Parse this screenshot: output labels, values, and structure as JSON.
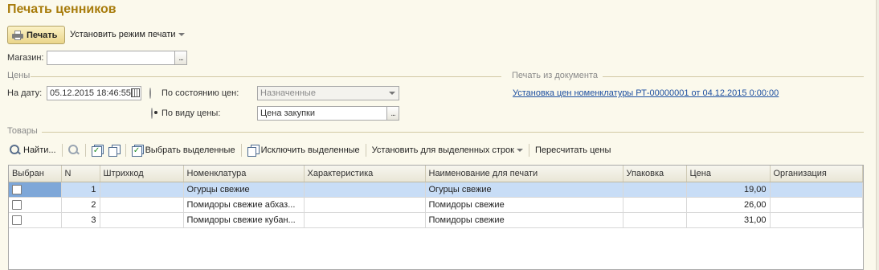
{
  "title": "Печать ценников",
  "toolbar": {
    "print_label": "Печать",
    "mode_label": "Установить режим печати"
  },
  "store": {
    "label": "Магазин:",
    "value": ""
  },
  "prices": {
    "section_title": "Цены",
    "date_label": "На дату:",
    "date_value": "05.12.2015 18:46:55",
    "by_state_label": "По состоянию цен:",
    "by_state_value": "Назначенные",
    "by_type_label": "По виду цены:",
    "by_type_value": "Цена закупки",
    "selected_option": "by_type"
  },
  "print_from_doc": {
    "section_title": "Печать из документа",
    "link_text": "Установка цен номенклатуры РТ-00000001 от 04.12.2015 0:00:00"
  },
  "goods": {
    "section_title": "Товары",
    "toolbar": {
      "find_label": "Найти...",
      "select_selected_label": "Выбрать выделенные",
      "exclude_selected_label": "Исключить выделенные",
      "set_for_rows_label": "Установить для выделенных строк",
      "recalc_label": "Пересчитать цены"
    },
    "columns": [
      "Выбран",
      "N",
      "Штрихкод",
      "Номенклатура",
      "Характеристика",
      "Наименование для печати",
      "Упаковка",
      "Цена",
      "Организация"
    ],
    "rows": [
      {
        "selected": false,
        "n": "1",
        "barcode": "",
        "item": "Огурцы свежие",
        "characteristic": "",
        "print_name": "Огурцы свежие",
        "package": "",
        "price": "19,00",
        "organization": ""
      },
      {
        "selected": false,
        "n": "2",
        "barcode": "",
        "item": "Помидоры свежие абхаз...",
        "characteristic": "",
        "print_name": "Помидоры свежие",
        "package": "",
        "price": "26,00",
        "organization": ""
      },
      {
        "selected": false,
        "n": "3",
        "barcode": "",
        "item": "Помидоры свежие кубан...",
        "characteristic": "",
        "print_name": "Помидоры свежие",
        "package": "",
        "price": "31,00",
        "organization": ""
      }
    ]
  },
  "colors": {
    "title": "#a87c0c",
    "link": "#1d4fa0",
    "selected_row": "#c8ddf6",
    "background": "#fbf9ec"
  }
}
